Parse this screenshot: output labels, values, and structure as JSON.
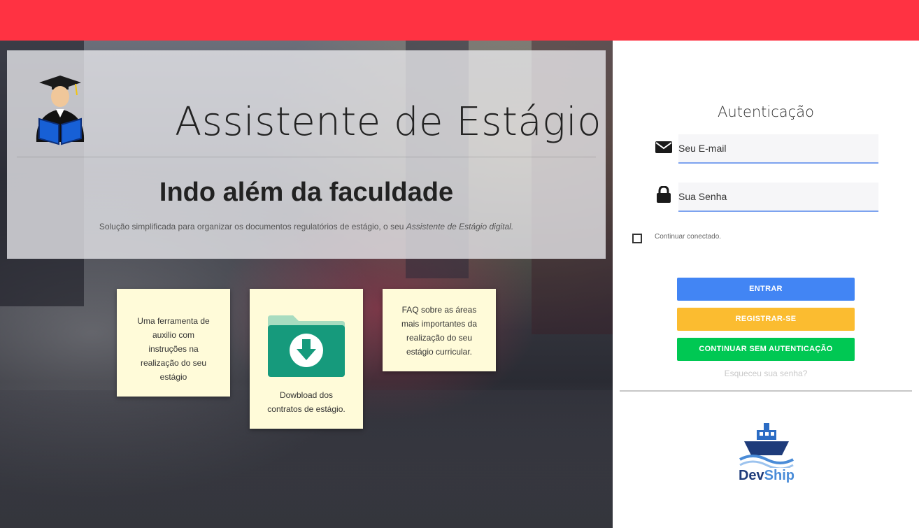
{
  "hero": {
    "title": "Assistente de Estágio",
    "tagline": "Indo além da faculdade",
    "subtitle_text": "Solução simplificada para organizar os documentos regulatórios de estágio, o seu ",
    "subtitle_emphasis": "Assistente de Estágio digital."
  },
  "cards": [
    {
      "text": "Uma ferramenta de auxilio com instruções na realização do seu estágio"
    },
    {
      "text": "Dowbload dos contratos de estágio.",
      "icon": "download-folder-icon"
    },
    {
      "text": "FAQ sobre as áreas mais importantes da realização do seu estágio curricular."
    }
  ],
  "auth": {
    "title": "Autenticação",
    "email_placeholder": "Seu E-mail",
    "password_placeholder": "Sua Senha",
    "remember_label": "Continuar conectado.",
    "login_label": "ENTRAR",
    "register_label": "REGISTRAR-SE",
    "guest_label": "CONTINUAR SEM AUTENTICAÇÃO",
    "forgot_label": "Esqueceu sua senha?"
  },
  "brand": {
    "part1": "Dev",
    "part2": "Ship"
  },
  "colors": {
    "topbar": "#ff3242",
    "login": "#4285f4",
    "register": "#fbbc30",
    "guest": "#00c853"
  }
}
